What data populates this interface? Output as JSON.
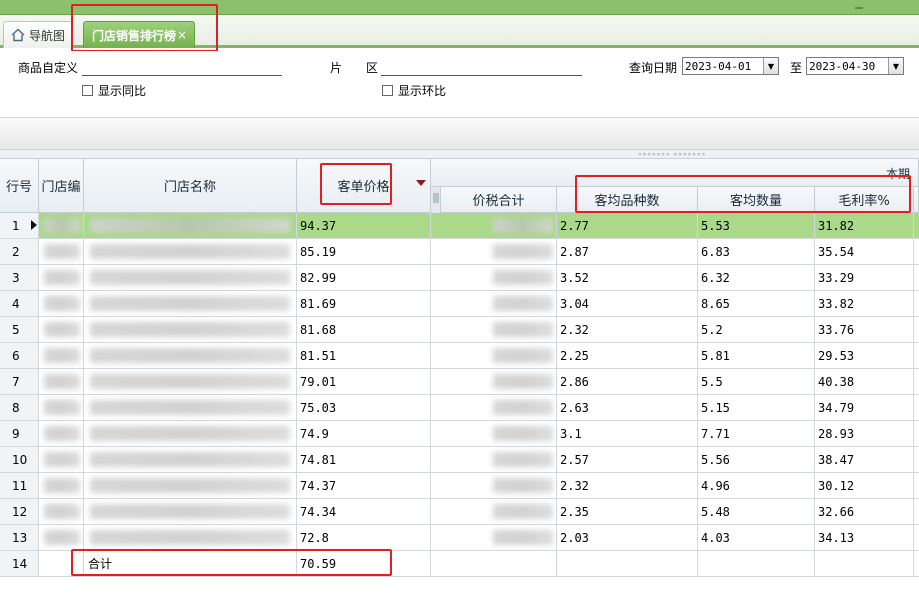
{
  "tabs": {
    "home_label": "导航图",
    "active_label": "门店销售排行榜",
    "active_close": "×"
  },
  "filters": {
    "product_custom_label": "商品自定义",
    "region_label": "片　　区",
    "show_yoy_label": "显示同比",
    "show_mom_label": "显示环比",
    "query_date_label": "查询日期",
    "to_label": "至",
    "date_from": "2023-04-01",
    "date_to": "2023-04-30"
  },
  "grid": {
    "period_label": "本期",
    "columns": {
      "row_no": "行号",
      "store_code": "门店编",
      "store_name": "门店名称",
      "avg_ticket": "客单价格",
      "tax_total": "价税合计",
      "avg_sku": "客均品种数",
      "avg_qty": "客均数量",
      "margin": "毛利率%"
    },
    "rows": [
      {
        "no": "1",
        "avg_ticket": "94.37",
        "avg_sku": "2.77",
        "avg_qty": "5.53",
        "margin": "31.82"
      },
      {
        "no": "2",
        "avg_ticket": "85.19",
        "avg_sku": "2.87",
        "avg_qty": "6.83",
        "margin": "35.54"
      },
      {
        "no": "3",
        "avg_ticket": "82.99",
        "avg_sku": "3.52",
        "avg_qty": "6.32",
        "margin": "33.29"
      },
      {
        "no": "4",
        "avg_ticket": "81.69",
        "avg_sku": "3.04",
        "avg_qty": "8.65",
        "margin": "33.82"
      },
      {
        "no": "5",
        "avg_ticket": "81.68",
        "avg_sku": "2.32",
        "avg_qty": "5.2",
        "margin": "33.76"
      },
      {
        "no": "6",
        "avg_ticket": "81.51",
        "avg_sku": "2.25",
        "avg_qty": "5.81",
        "margin": "29.53"
      },
      {
        "no": "7",
        "avg_ticket": "79.01",
        "avg_sku": "2.86",
        "avg_qty": "5.5",
        "margin": "40.38"
      },
      {
        "no": "8",
        "avg_ticket": "75.03",
        "avg_sku": "2.63",
        "avg_qty": "5.15",
        "margin": "34.79"
      },
      {
        "no": "9",
        "avg_ticket": "74.9",
        "avg_sku": "3.1",
        "avg_qty": "7.71",
        "margin": "28.93"
      },
      {
        "no": "10",
        "avg_ticket": "74.81",
        "avg_sku": "2.57",
        "avg_qty": "5.56",
        "margin": "38.47"
      },
      {
        "no": "11",
        "avg_ticket": "74.37",
        "avg_sku": "2.32",
        "avg_qty": "4.96",
        "margin": "30.12"
      },
      {
        "no": "12",
        "avg_ticket": "74.34",
        "avg_sku": "2.35",
        "avg_qty": "5.48",
        "margin": "32.66"
      },
      {
        "no": "13",
        "avg_ticket": "72.8",
        "avg_sku": "2.03",
        "avg_qty": "4.03",
        "margin": "34.13"
      }
    ],
    "total_row": {
      "no": "14",
      "label": "合计",
      "avg_ticket": "70.59"
    }
  },
  "colors": {
    "accent_green": "#8bc16a",
    "selected_row": "#a9d989",
    "highlight_red": "#e02020"
  },
  "icons": {
    "home": "home-icon",
    "dropdown": "chevron-down-icon",
    "sort": "sort-desc-icon",
    "row_pointer": "row-pointer-icon"
  }
}
